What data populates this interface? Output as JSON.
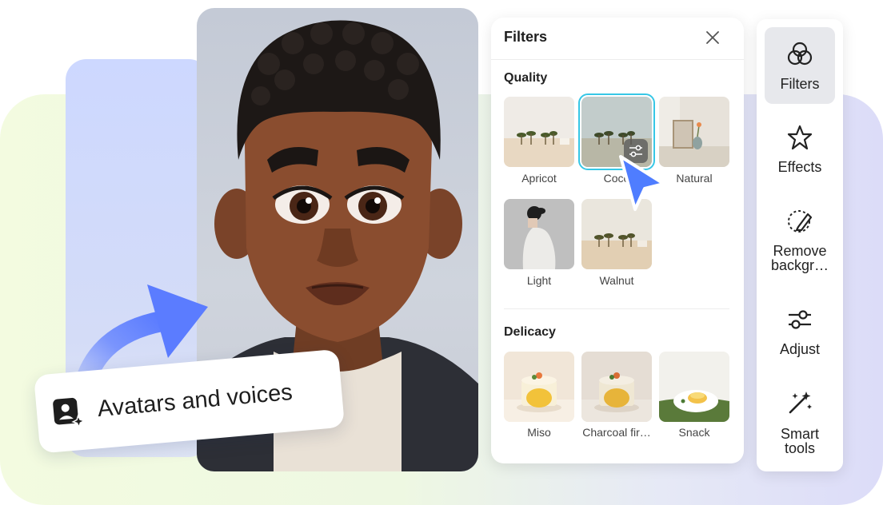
{
  "chip": {
    "label": "Avatars and voices",
    "icon": "user-sparkle-icon"
  },
  "filters_panel": {
    "title": "Filters",
    "close_icon": "close-icon",
    "sections": [
      {
        "title": "Quality",
        "items": [
          "Apricot",
          "Coco",
          "Natural",
          "Light",
          "Walnut"
        ]
      },
      {
        "title": "Delicacy",
        "items": [
          "Miso",
          "Charcoal fir…",
          "Snack"
        ]
      }
    ],
    "selected_item": "Coco",
    "selected_badge_icon": "sliders-icon"
  },
  "tools": [
    {
      "label": "Filters",
      "icon": "filters-icon",
      "active": true
    },
    {
      "label": "Effects",
      "icon": "star-outline-icon"
    },
    {
      "label": "Remove backgr…",
      "icon": "eraser-icon"
    },
    {
      "label": "Adjust",
      "icon": "sliders-icon"
    },
    {
      "label": "Smart tools",
      "icon": "magic-wand-icon"
    }
  ],
  "colors": {
    "accent_arrow": "#5b7cff",
    "selection": "#37c7e6",
    "cursor": "#4f7dff"
  }
}
